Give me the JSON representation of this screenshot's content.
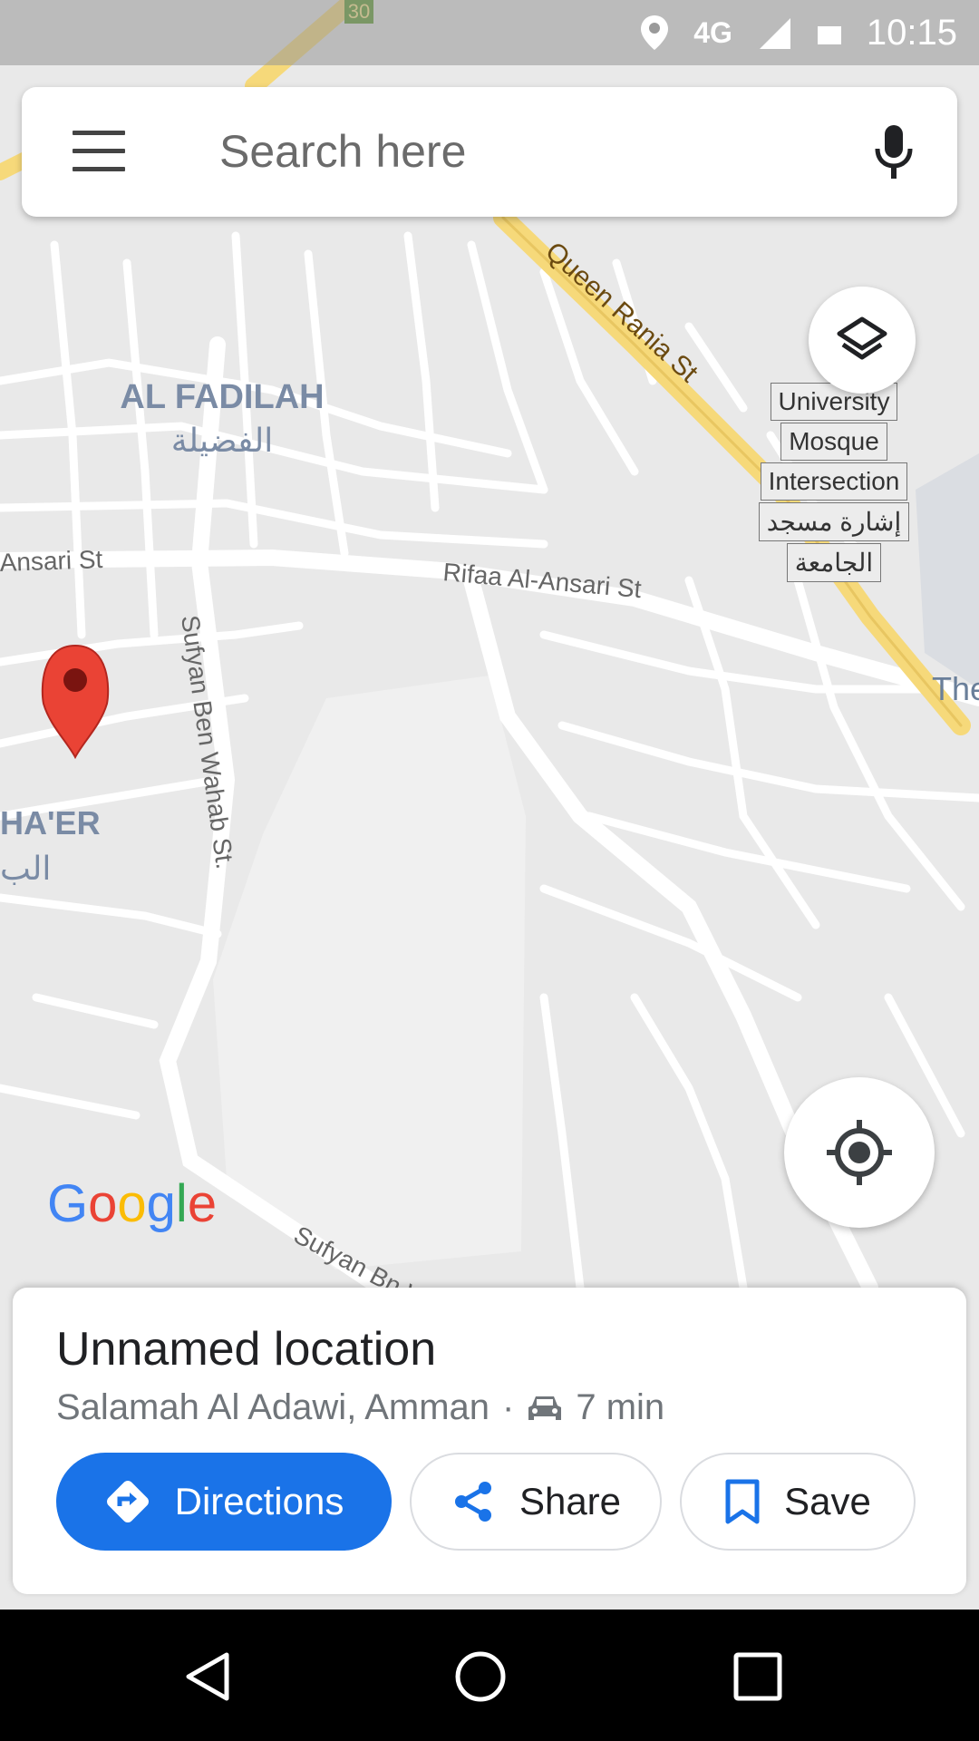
{
  "status_bar": {
    "network": "4G",
    "time": "10:15"
  },
  "search": {
    "placeholder": "Search here"
  },
  "map": {
    "labels": {
      "al_fadilah_en": "AL FADILAH",
      "al_fadilah_ar": "الفضيلة",
      "ansari_st_left": "Ansari St",
      "rifaa_st": "Rifaa Al-Ansari St",
      "queen_rania_st": "Queen Rania St",
      "sufyan_wahab_st": "Sufyan Ben Wahab St.",
      "sufyan_bottom": "Sufyan Bn W...",
      "haer_en": "HA'ER",
      "haer_ar": "الب",
      "the_right": "The",
      "road_shield": "30"
    },
    "landmark": [
      "University",
      "Mosque",
      "Intersection",
      "إشارة مسجد",
      "الجامعة"
    ],
    "logo": "Google"
  },
  "place": {
    "title": "Unnamed location",
    "address": "Salamah Al Adawi, Amman",
    "separator": "·",
    "travel_time": "7 min"
  },
  "actions": {
    "directions": "Directions",
    "share": "Share",
    "save": "Save"
  },
  "colors": {
    "accent": "#1a73e8",
    "pin": "#ea4335",
    "road_major": "#f6d97a",
    "map_bg": "#e9e9e9"
  }
}
